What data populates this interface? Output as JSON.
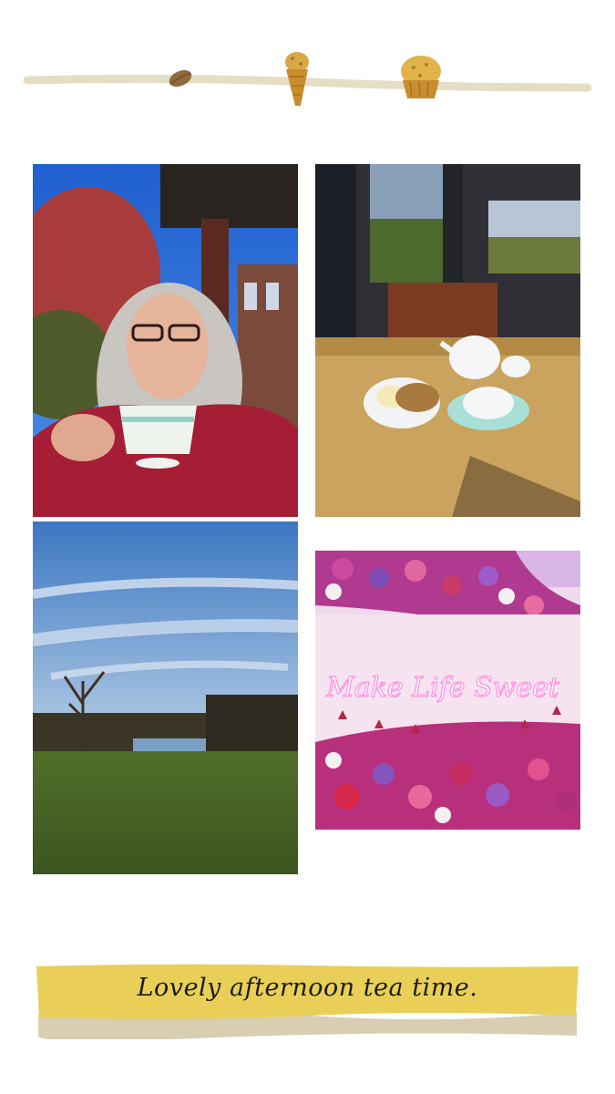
{
  "caption": "Lovely afternoon tea time.",
  "colors": {
    "banner_yellow": "#e9cf57",
    "banner_shadow": "#d8cfb3",
    "top_line": "#e4dec4",
    "pastry": "#d9a844",
    "almond": "#8f6a3c"
  },
  "photos": [
    {
      "name": "selfie-with-teacup"
    },
    {
      "name": "tea-table-on-porch"
    },
    {
      "name": "lawn-and-lake"
    },
    {
      "name": "make-life-sweet-flower-wall",
      "neon_text": "Make Life Sweet"
    }
  ],
  "icons": [
    "almond-icon",
    "muffin-icon",
    "muffin-icon"
  ]
}
